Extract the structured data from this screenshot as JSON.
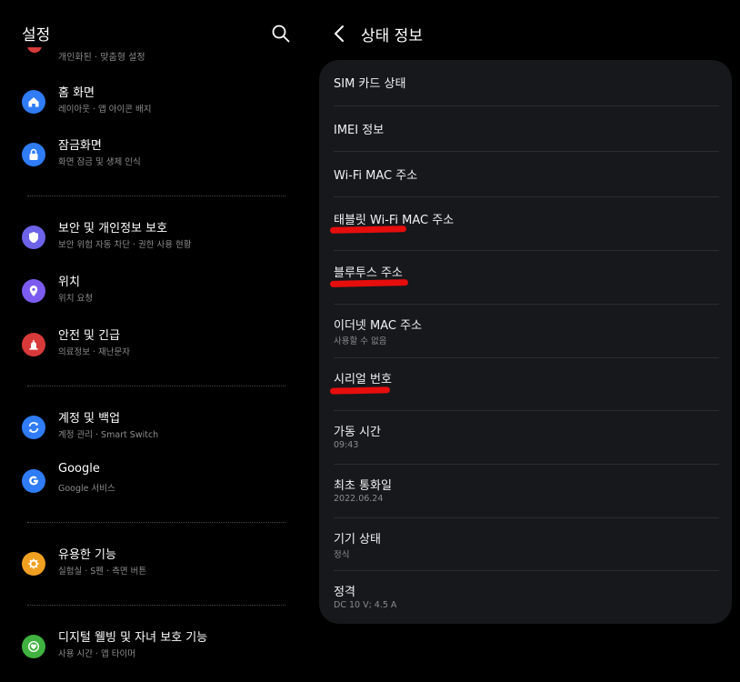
{
  "colors": {
    "background": "#000000",
    "card": "#17181c",
    "accent_home": "#2f7cf6",
    "accent_lock": "#2f7cf6",
    "accent_security": "#6c63e8",
    "accent_location": "#7c5cf0",
    "accent_safety": "#d83a3a",
    "accent_account": "#2f7cf6",
    "accent_google": "#2f7cf6",
    "accent_advanced": "#f0a020",
    "accent_wellbeing": "#3fb23f",
    "highlight_mark": "#e60d0d"
  },
  "left": {
    "title": "설정",
    "search_icon": "search-icon",
    "partial_item_sub": "개인화된 · 맞춤형 설정",
    "items": [
      {
        "label": "홈 화면",
        "sub": "레이아웃 · 앱 아이콘 배지",
        "icon": "home-icon"
      },
      {
        "label": "잠금화면",
        "sub": "화면 잠금 및 생체 인식",
        "icon": "lock-icon"
      },
      {
        "label": "보안 및 개인정보 보호",
        "sub": "보안 위험 자동 차단 · 권한 사용 현황",
        "icon": "shield-icon"
      },
      {
        "label": "위치",
        "sub": "위치 요청",
        "icon": "location-pin-icon"
      },
      {
        "label": "안전 및 긴급",
        "sub": "의료정보 · 재난문자",
        "icon": "emergency-icon"
      },
      {
        "label": "계정 및 백업",
        "sub": "계정 관리 · Smart Switch",
        "icon": "sync-icon"
      },
      {
        "label": "Google",
        "sub": "Google 서비스",
        "icon": "google-icon"
      },
      {
        "label": "유용한 기능",
        "sub": "실험실 · S펜 · 측면 버튼",
        "icon": "gear-icon"
      },
      {
        "label": "디지털 웰빙 및 자녀 보호 기능",
        "sub": "사용 시간 · 앱 타이머",
        "icon": "heart-icon"
      }
    ]
  },
  "right": {
    "title": "상태 정보",
    "back_icon": "back-arrow-icon",
    "rows": [
      {
        "label": "SIM 카드 상태",
        "sub": ""
      },
      {
        "label": "IMEI 정보",
        "sub": ""
      },
      {
        "label": "Wi-Fi MAC 주소",
        "sub": ""
      },
      {
        "label": "태블릿 Wi-Fi MAC 주소",
        "sub": ""
      },
      {
        "label": "블루투스 주소",
        "sub": ""
      },
      {
        "label": "이더넷 MAC 주소",
        "sub": "사용할 수 없음"
      },
      {
        "label": "시리얼 번호",
        "sub": ""
      },
      {
        "label": "가동 시간",
        "sub": "09:43"
      },
      {
        "label": "최초 통화일",
        "sub": "2022.06.24"
      },
      {
        "label": "기기 상태",
        "sub": "정식"
      },
      {
        "label": "정격",
        "sub": "DC 10 V; 4.5 A"
      }
    ]
  }
}
